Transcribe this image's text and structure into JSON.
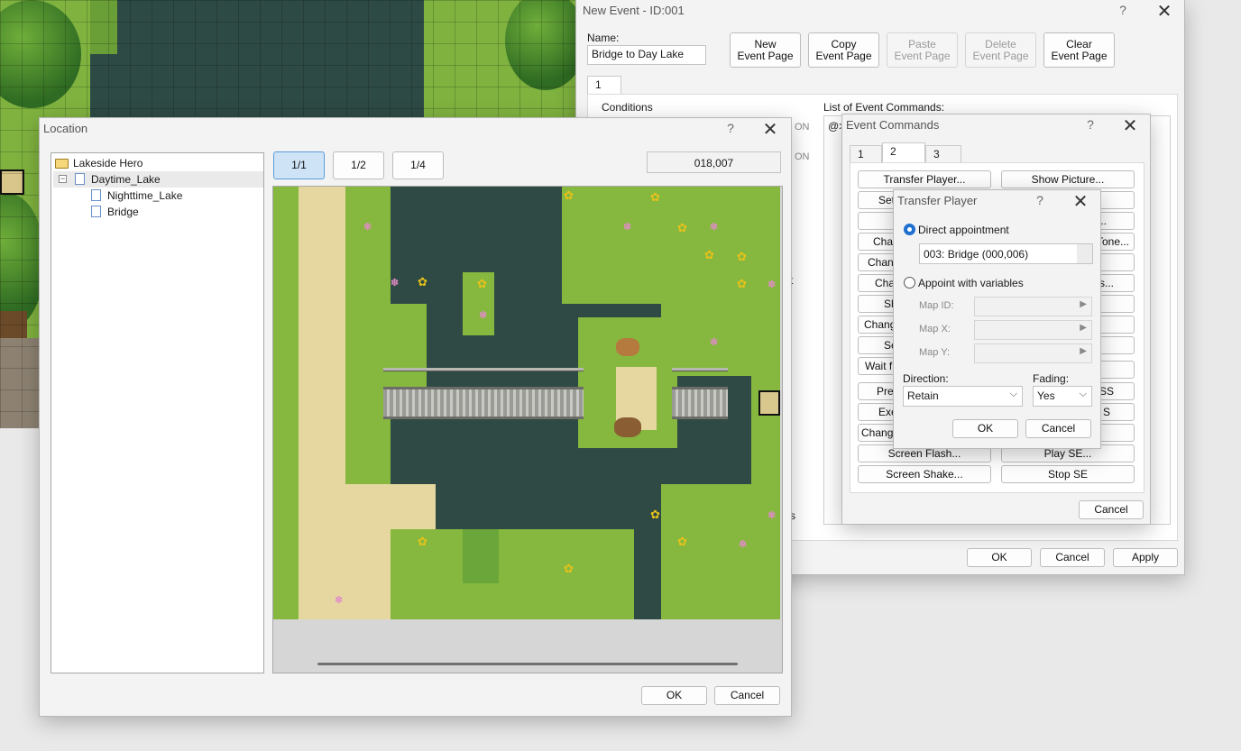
{
  "new_event": {
    "title": "New Event - ID:001",
    "help": "?",
    "close": "✕",
    "name_label": "Name:",
    "name_value": "Bridge to Day Lake",
    "buttons": {
      "new_line1": "New",
      "new_line2": "Event Page",
      "copy_line1": "Copy",
      "copy_line2": "Event Page",
      "paste_line1": "Paste",
      "paste_line2": "Event Page",
      "delete_line1": "Delete",
      "delete_line2": "Event Page",
      "clear_line1": "Clear",
      "clear_line2": "Event Page"
    },
    "page_tab": "1",
    "conditions_label": "Conditions",
    "list_label": "List of Event Commands:",
    "list_first": "@>",
    "on1": "ON",
    "on2": "ON",
    "fragment_t": "t",
    "fragment_s": "s",
    "ok": "OK",
    "cancel": "Cancel",
    "apply": "Apply"
  },
  "event_commands": {
    "title": "Event Commands",
    "help": "?",
    "close": "✕",
    "tabs": [
      "1",
      "2",
      "3"
    ],
    "left_buttons": [
      "Transfer Player...",
      "Set",
      "",
      "Char",
      "Chang",
      "Cha",
      "Sh",
      "Chang",
      "Se",
      "Wait f",
      "Prep",
      "Exe",
      "Change",
      "Screen Flash...",
      "Screen Shake..."
    ],
    "right_buttons": [
      "Show Picture...",
      "",
      "..",
      "Tone...",
      "",
      "s...",
      "",
      "",
      "",
      "",
      "SS",
      "S",
      "",
      "Play SE...",
      "Stop SE"
    ],
    "cancel": "Cancel"
  },
  "transfer_player": {
    "title": "Transfer Player",
    "help": "?",
    "close": "✕",
    "direct_label": "Direct appointment",
    "direct_value": "003: Bridge (000,006)",
    "variables_label": "Appoint with variables",
    "map_id_label": "Map ID:",
    "map_x_label": "Map X:",
    "map_y_label": "Map Y:",
    "direction_label": "Direction:",
    "direction_value": "Retain",
    "fading_label": "Fading:",
    "fading_value": "Yes",
    "ok": "OK",
    "cancel": "Cancel"
  },
  "location": {
    "title": "Location",
    "help": "?",
    "close": "✕",
    "tree": {
      "root": "Lakeside Hero",
      "expander": "−",
      "items": [
        "Daytime_Lake",
        "Nighttime_Lake",
        "Bridge"
      ]
    },
    "zoom": [
      "1/1",
      "1/2",
      "1/4"
    ],
    "coords": "018,007",
    "ok": "OK",
    "cancel": "Cancel"
  }
}
